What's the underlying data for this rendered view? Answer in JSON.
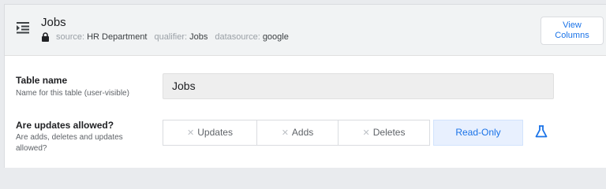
{
  "header": {
    "title": "Jobs",
    "meta": {
      "source_label": "source:",
      "source_value": "HR Department",
      "qualifier_label": "qualifier:",
      "qualifier_value": "Jobs",
      "datasource_label": "datasource:",
      "datasource_value": "google"
    },
    "view_columns_line1": "View",
    "view_columns_line2": "Columns"
  },
  "table_name": {
    "label": "Table name",
    "description": "Name for this table (user-visible)",
    "value": "Jobs"
  },
  "updates": {
    "label": "Are updates allowed?",
    "description": "Are adds, deletes and updates allowed?",
    "options": [
      {
        "label": "Updates",
        "selected": false
      },
      {
        "label": "Adds",
        "selected": false
      },
      {
        "label": "Deletes",
        "selected": false
      },
      {
        "label": "Read-Only",
        "selected": true
      }
    ]
  },
  "icons": {
    "menu": "menu-collapse-icon",
    "lock": "lock-icon",
    "flask": "flask-icon"
  },
  "colors": {
    "accent": "#1a73e8",
    "header_bg": "#f1f3f4",
    "input_bg": "#eeeeee",
    "selected_bg": "#e8f0fe"
  }
}
